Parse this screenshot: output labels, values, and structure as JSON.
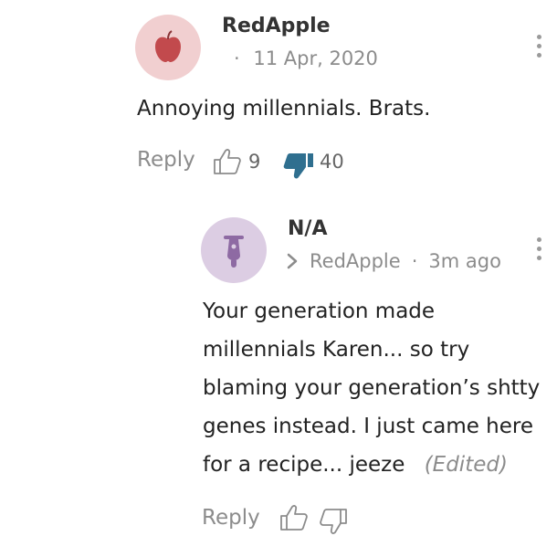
{
  "comments": [
    {
      "username": "RedApple",
      "separator": "·",
      "date": "11 Apr, 2020",
      "text": "Annoying millennials. Brats.",
      "reply_label": "Reply",
      "likes": "9",
      "dislikes": "40"
    }
  ],
  "reply": {
    "username": "N/A",
    "reply_to": "RedApple",
    "separator": "·",
    "time": "3m ago",
    "lines": [
      "Your generation made",
      "millennials Karen... so  try",
      "blaming your generation’s shtty",
      "genes instead. I just came here",
      "for a recipe... jeeze"
    ],
    "edited_label": "(Edited)",
    "reply_label": "Reply"
  },
  "colors": {
    "avatar1_bg": "#f1cfd0",
    "avatar2_bg": "#dccde3",
    "apple_icon": "#c24a4d",
    "scooter_icon": "#8e6aa3",
    "thumbs_down_active": "#2f6f8f"
  }
}
